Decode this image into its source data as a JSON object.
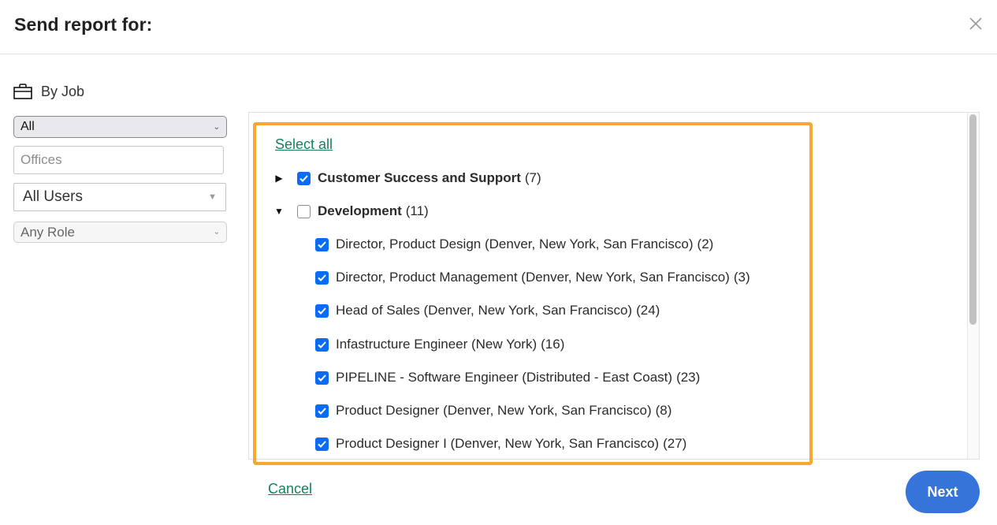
{
  "header": {
    "title": "Send report for:",
    "close_icon": "close-icon"
  },
  "filters": {
    "section_label": "By Job",
    "section_icon": "briefcase-icon",
    "job_status_select": {
      "value": "All"
    },
    "offices_input": {
      "value": "",
      "placeholder": "Offices"
    },
    "users_select": {
      "value": "All Users"
    },
    "role_select": {
      "value": "Any Role"
    }
  },
  "job_list": {
    "select_all_label": "Select all",
    "groups": [
      {
        "name": "Customer Success and Support",
        "count": "(7)",
        "expanded": false,
        "checked": true,
        "jobs": []
      },
      {
        "name": "Development",
        "count": "(11)",
        "expanded": true,
        "checked": false,
        "jobs": [
          {
            "label": "Director, Product Design (Denver, New York, San Francisco)",
            "count": "(2)",
            "checked": true
          },
          {
            "label": "Director, Product Management (Denver, New York, San Francisco)",
            "count": "(3)",
            "checked": true
          },
          {
            "label": "Head of Sales (Denver, New York, San Francisco)",
            "count": "(24)",
            "checked": true
          },
          {
            "label": "Infastructure Engineer (New York)",
            "count": "(16)",
            "checked": true
          },
          {
            "label": "PIPELINE - Software Engineer (Distributed - East Coast)",
            "count": "(23)",
            "checked": true
          },
          {
            "label": "Product Designer (Denver, New York, San Francisco)",
            "count": "(8)",
            "checked": true
          },
          {
            "label": "Product Designer I (Denver, New York, San Francisco)",
            "count": "(27)",
            "checked": true
          }
        ]
      }
    ],
    "highlight_color": "#f8a731"
  },
  "footer": {
    "cancel_label": "Cancel",
    "next_label": "Next"
  },
  "colors": {
    "link": "#14825d",
    "primary_button": "#3674d9",
    "checkbox_checked": "#0a6cf5"
  }
}
